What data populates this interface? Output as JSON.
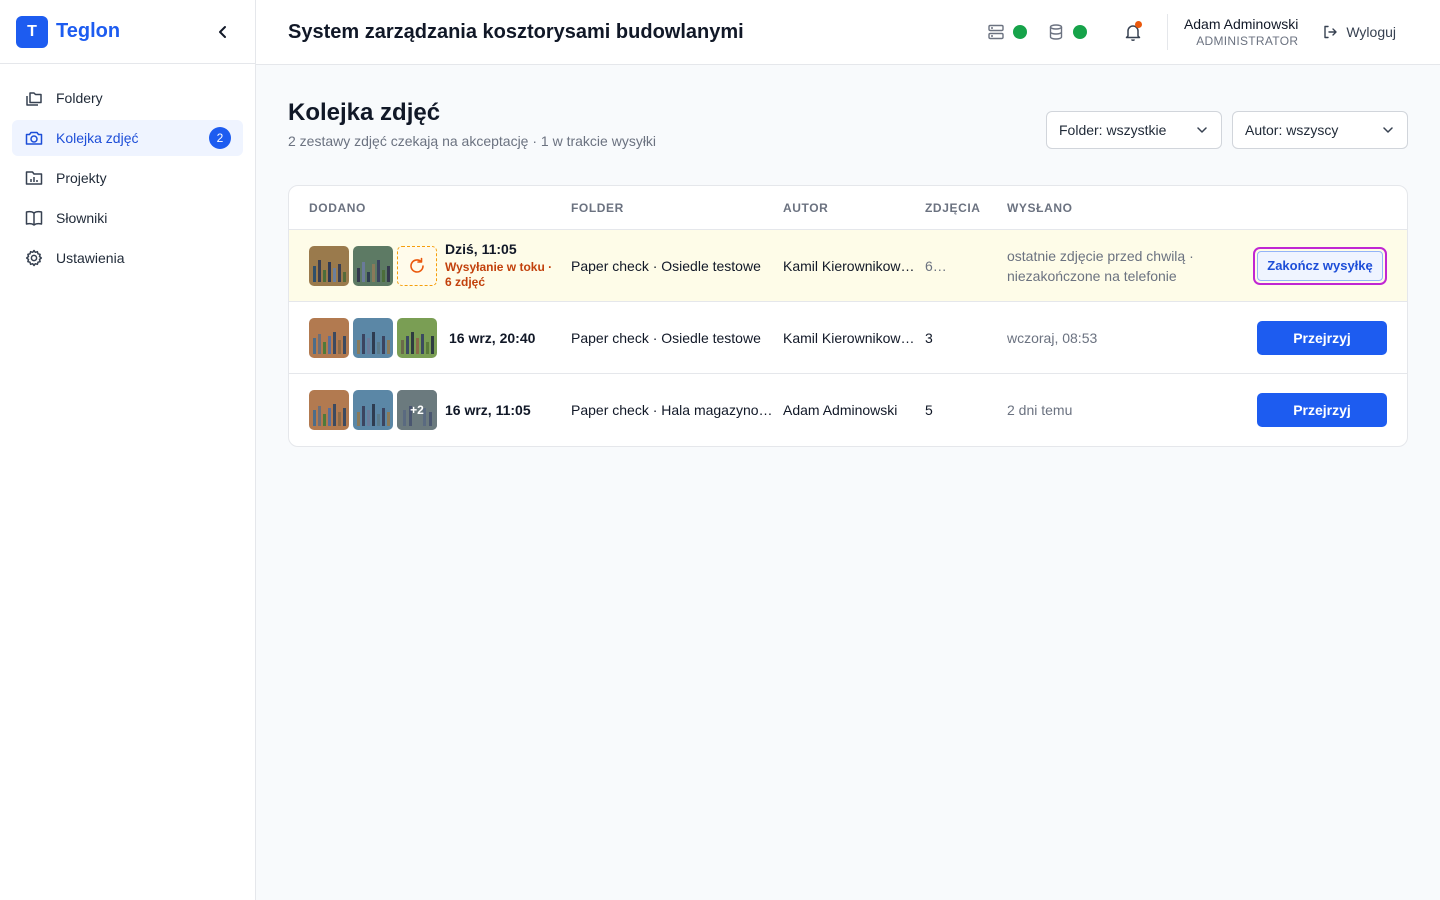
{
  "brand": {
    "logo_letter": "T",
    "name": "Teglon"
  },
  "sidebar": {
    "items": [
      {
        "label": "Foldery",
        "icon": "folders-icon",
        "active": false
      },
      {
        "label": "Kolejka zdjęć",
        "icon": "camera-icon",
        "active": true,
        "badge": "2"
      },
      {
        "label": "Projekty",
        "icon": "project-chart-icon",
        "active": false
      },
      {
        "label": "Słowniki",
        "icon": "book-icon",
        "active": false
      },
      {
        "label": "Ustawienia",
        "icon": "gear-icon",
        "active": false
      }
    ]
  },
  "header": {
    "title": "System zarządzania kosztorysami budowlanymi",
    "status": [
      {
        "icon": "server-icon",
        "color": "#16a34a"
      },
      {
        "icon": "database-icon",
        "color": "#16a34a"
      }
    ],
    "notifications_icon": "bell-icon",
    "user": {
      "name": "Adam Adminowski",
      "role": "ADMINISTRATOR"
    },
    "logout_label": "Wyloguj"
  },
  "page": {
    "title": "Kolejka zdjęć",
    "subtitle": "2 zestawy zdjęć czekają na akceptację · 1 w trakcie wysyłki",
    "filters": {
      "folder": "Folder: wszystkie",
      "author": "Autor: wszyscy"
    }
  },
  "table": {
    "columns": [
      "DODANO",
      "FOLDER",
      "AUTOR",
      "ZDJĘCIA",
      "WYSŁANO"
    ],
    "rows": [
      {
        "date": "Dziś, 11:05",
        "status": "Wysyłanie w toku · 6 zdjęć",
        "folder": "Paper check · Osiedle testowe",
        "author": "Kamil Kierownikowski",
        "count": "6…",
        "sent": "ostatnie zdjęcie przed chwilą · niezakończone na telefonie",
        "action": "Zakończ wysyłkę",
        "highlight": true
      },
      {
        "date": "16 wrz, 20:40",
        "folder": "Paper check · Osiedle testowe",
        "author": "Kamil Kierownikowski",
        "count": "3",
        "sent": "wczoraj, 08:53",
        "action": "Przejrzyj"
      },
      {
        "date": "16 wrz, 11:05",
        "folder": "Paper check · Hala magazynowa",
        "author": "Adam Adminowski",
        "count": "5",
        "sent": "2 dni temu",
        "action": "Przejrzyj",
        "more_photos": "+2"
      }
    ]
  },
  "colors": {
    "accent": "#1d5cf0",
    "warning": "#c2410c",
    "highlight_row": "#fefce8",
    "focus_ring": "#c026d3"
  }
}
